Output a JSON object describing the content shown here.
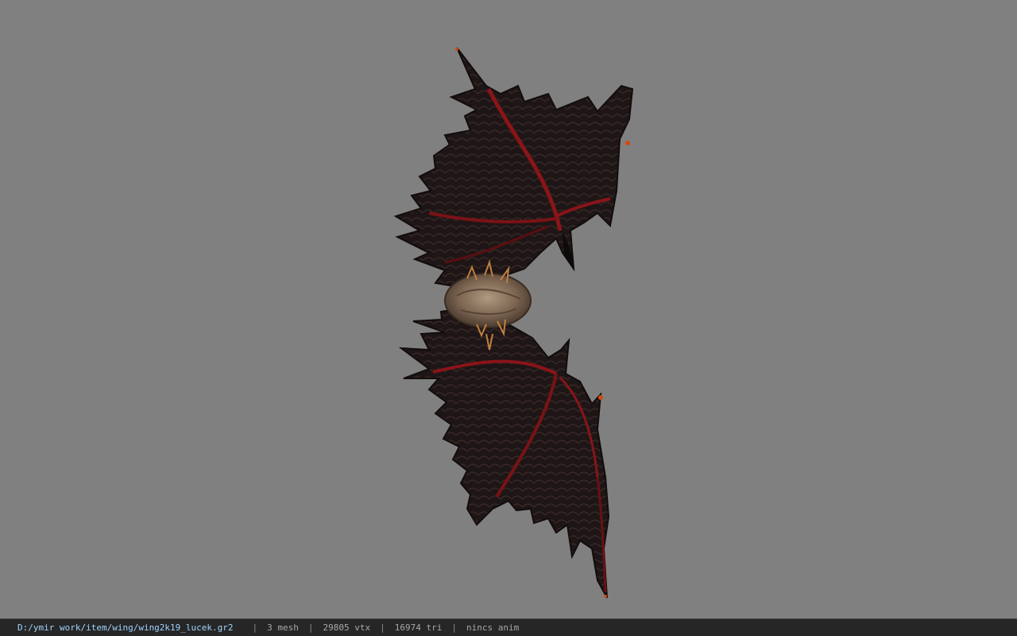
{
  "viewer": {
    "background_color": "#808080",
    "model_icon": "winged-creature-icon"
  },
  "status_bar": {
    "file_path": "D:/ymir work/item/wing/wing2k19_lucek.gr2",
    "separator": "|",
    "mesh_count": "3 mesh",
    "vertex_count": "29805 vtx",
    "triangle_count": "16974 tri",
    "anim_status": "nincs anim"
  },
  "colors": {
    "wing_membrane": "#1e1616",
    "wing_vein": "#8a1418",
    "wing_tip_glow": "#d24a10",
    "body": "#8c7560",
    "status_bar_bg": "#262626",
    "status_path": "#9fd3ff",
    "status_text": "#a8a8a8"
  }
}
